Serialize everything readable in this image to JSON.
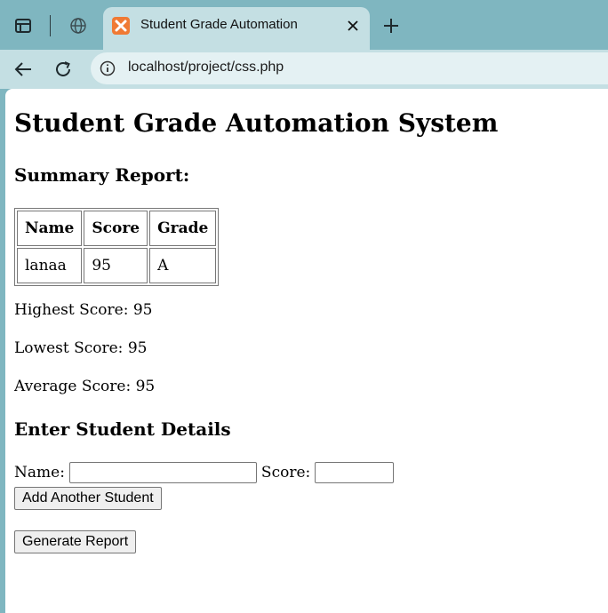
{
  "browser": {
    "tab_title": "Student Grade Automation",
    "url": "localhost/project/css.php"
  },
  "page": {
    "title": "Student Grade Automation System",
    "summary_heading": "Summary Report:",
    "table": {
      "headers": [
        "Name",
        "Score",
        "Grade"
      ],
      "rows": [
        [
          "lanaa",
          "95",
          "A"
        ]
      ]
    },
    "stats": {
      "highest": "Highest Score: 95",
      "lowest": "Lowest Score: 95",
      "average": "Average Score: 95"
    },
    "form": {
      "heading": "Enter Student Details",
      "name_label": "Name:",
      "name_value": "",
      "score_label": "Score:",
      "score_value": "",
      "add_button": "Add Another Student",
      "generate_button": "Generate Report"
    }
  },
  "colors": {
    "chrome_frame": "#7fb6c0",
    "chrome_toolbar": "#c4dfe3",
    "favicon": "#f07a34"
  }
}
